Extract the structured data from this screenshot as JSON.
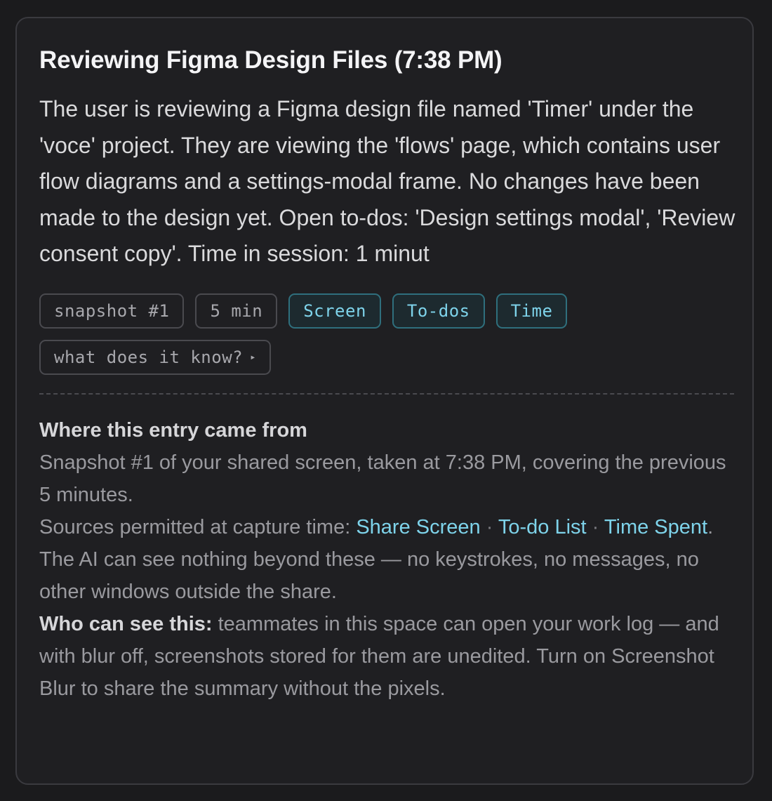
{
  "entry": {
    "title": "Reviewing Figma Design Files (7:38 PM)",
    "summary": "The user is reviewing a Figma design file named 'Timer' under the 'voce' project. They are viewing the 'flows' page, which contains user flow diagrams and a settings-modal frame. No changes have been made to the design yet. Open to-dos: 'Design settings modal', 'Review consent copy'. Time in session: 1 minut"
  },
  "chips": {
    "snapshot": "snapshot #1",
    "duration": "5 min",
    "screen": "Screen",
    "todos": "To-dos",
    "time": "Time",
    "what_it_knows": "what does it know?",
    "what_it_knows_arrow": "▸"
  },
  "provenance": {
    "heading": "Where this entry came from",
    "snapshot_line": "Snapshot #1 of your shared screen, taken at 7:38 PM, covering the previous 5 minutes.",
    "sources_prefix": "Sources permitted at capture time: ",
    "source_share_screen": "Share Screen",
    "source_todo_list": "To-do List",
    "source_time_spent": "Time Spent",
    "separator": " · ",
    "sources_suffix": ".",
    "limits_line": "The AI can see nothing beyond these — no keystrokes, no messages, no other windows outside the share.",
    "who_label": "Who can see this:",
    "who_text": " teammates in this space can open your work log — and with blur off, screenshots stored for them are unedited. Turn on Screenshot Blur to share the summary without the pixels."
  },
  "colors": {
    "background": "#1b1b1d",
    "card": "#1f1f22",
    "accent": "#7ed3ea",
    "muted_text": "#9a9a9f"
  }
}
